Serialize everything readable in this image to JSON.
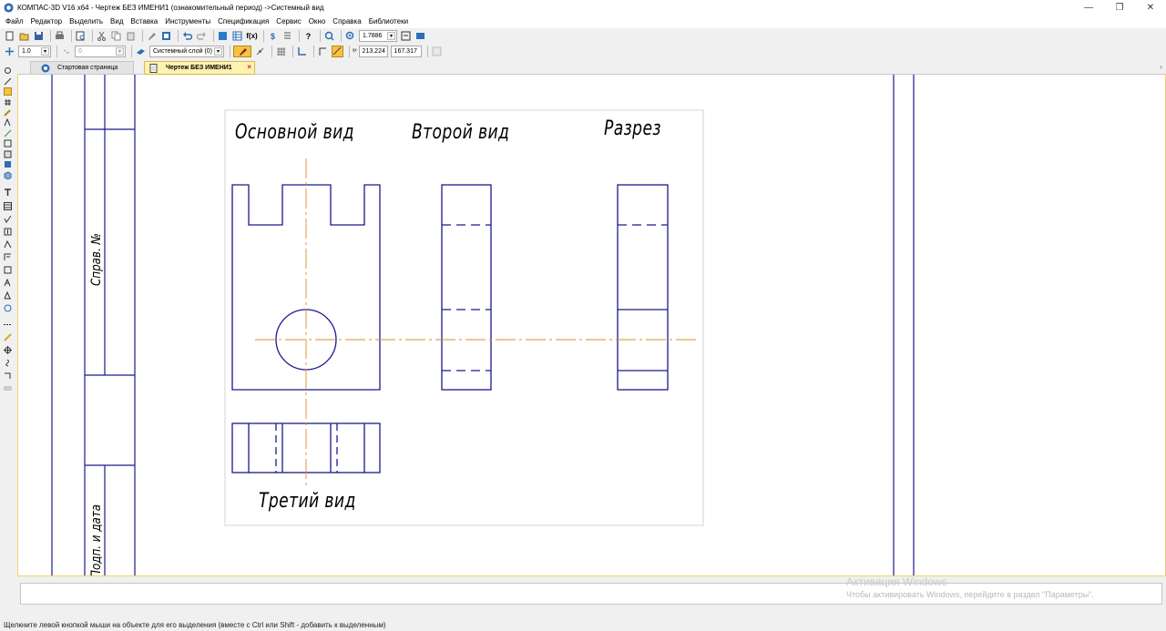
{
  "window": {
    "title": "КОМПАС-3D V16  x64 - Чертеж БЕЗ ИМЕНИ1 (ознакомительный период) ->Системный вид",
    "controls": [
      "—",
      "❐",
      "✕"
    ]
  },
  "menu": [
    "Файл",
    "Редактор",
    "Выделить",
    "Вид",
    "Вставка",
    "Инструменты",
    "Спецификация",
    "Сервис",
    "Окно",
    "Справка",
    "Библиотеки"
  ],
  "toolbar1": {
    "zoom_value": "1.7886"
  },
  "toolbar2": {
    "scale_value": "1.0",
    "step_value": "0",
    "layer_value": "Системный слой (0)",
    "coord_x": "213.224",
    "coord_y": "167.317"
  },
  "tabs": [
    {
      "label": "Стартовая страница",
      "active": false
    },
    {
      "label": "Чертеж БЕЗ ИМЕНИ1",
      "active": true
    }
  ],
  "drawing": {
    "views": {
      "main": "Основной вид",
      "second": "Второй вид",
      "section": "Разрез",
      "third": "Третий вид"
    },
    "stamp": {
      "sprav": "Справ. №",
      "podp": "Подп. и дата"
    },
    "colors": {
      "outline": "#1a1a8c",
      "axis": "#e08a2a",
      "frame": "#1a1a8c"
    }
  },
  "watermark": {
    "line1": "Активация Windows",
    "line2": "Чтобы активировать Windows, перейдите в раздел \"Параметры\"."
  },
  "status": "Щелкните левой кнопкой мыши на объекте для его выделения (вместе с Ctrl или Shift - добавить к выделенным)"
}
